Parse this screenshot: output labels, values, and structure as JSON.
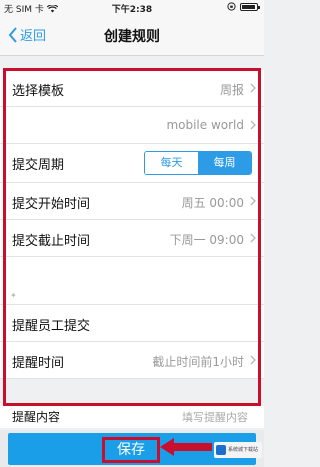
{
  "status_bar": {
    "carrier": "无 SIM 卡",
    "time": "下午2:38"
  },
  "nav": {
    "back_label": "返回",
    "title": "创建规则"
  },
  "form": {
    "template": {
      "label": "选择模板",
      "value": "周报"
    },
    "template_sub": {
      "value": "mobile world"
    },
    "cycle": {
      "label": "提交周期",
      "options": [
        "每天",
        "每周"
      ],
      "selected": "每周"
    },
    "start_time": {
      "label": "提交开始时间",
      "value": "周五 00:00"
    },
    "end_time": {
      "label": "提交截止时间",
      "value": "下周一 09:00"
    },
    "remind_staff": {
      "label": "提醒员工提交"
    },
    "remind_time": {
      "label": "提醒时间",
      "value": "截止时间前1小时"
    },
    "remind_content": {
      "label": "提醒内容",
      "placeholder": "填写提醒内容"
    }
  },
  "footer": {
    "save_label": "保存",
    "accent_color": "#1a9ee8",
    "highlight_color": "#c8102e"
  },
  "watermark": {
    "text": "系统城下载站"
  }
}
